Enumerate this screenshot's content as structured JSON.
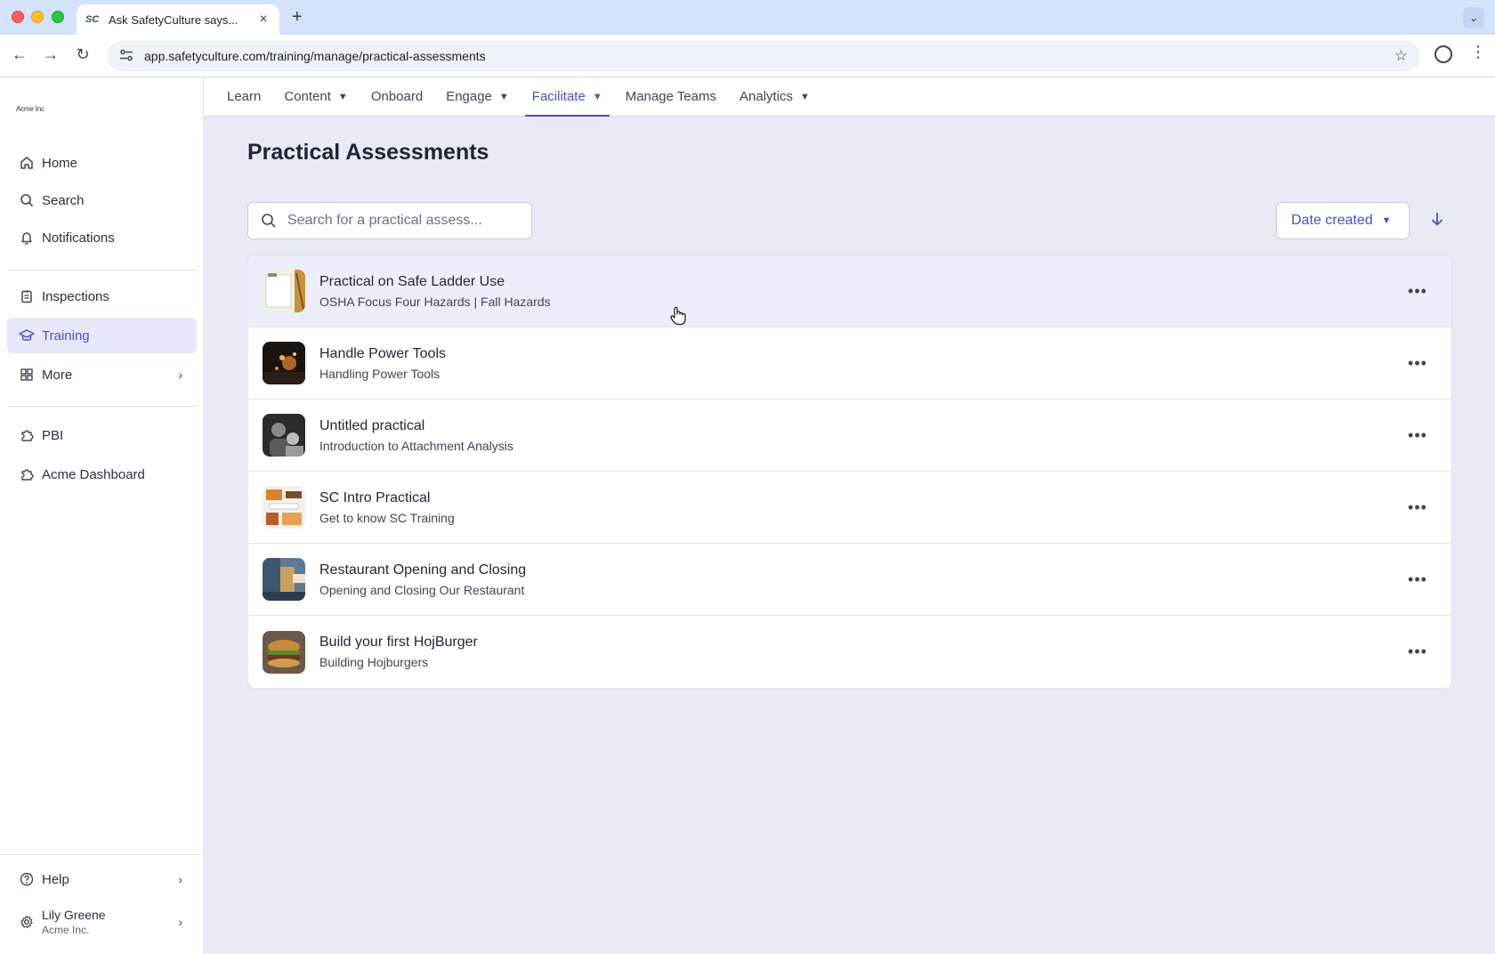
{
  "browser": {
    "tab_title": "Ask SafetyCulture says...",
    "tab_favicon": "SC",
    "url": "app.safetyculture.com/training/manage/practical-assessments",
    "icons": [
      "back-icon",
      "forward-icon",
      "reload-icon",
      "site-settings-icon",
      "bookmark-star-icon",
      "profile-icon",
      "menu-icon"
    ]
  },
  "brand": {
    "logo_text": "Acme Inc"
  },
  "sidebar": {
    "items": [
      {
        "label": "Home",
        "icon": "home-icon"
      },
      {
        "label": "Search",
        "icon": "search-icon"
      },
      {
        "label": "Notifications",
        "icon": "bell-icon"
      },
      {
        "label": "Inspections",
        "icon": "clipboard-icon"
      },
      {
        "label": "Training",
        "icon": "graduation-cap-icon",
        "active": true
      },
      {
        "label": "More",
        "icon": "grid-icon"
      },
      {
        "label": "PBI",
        "icon": "puzzle-icon"
      },
      {
        "label": "Acme Dashboard",
        "icon": "puzzle-icon"
      }
    ],
    "help_label": "Help",
    "user": {
      "name": "Lily Greene",
      "org": "Acme Inc."
    }
  },
  "topnav": {
    "items": [
      {
        "label": "Learn"
      },
      {
        "label": "Content",
        "dropdown": true
      },
      {
        "label": "Onboard"
      },
      {
        "label": "Engage",
        "dropdown": true
      },
      {
        "label": "Facilitate",
        "dropdown": true,
        "active": true
      },
      {
        "label": "Manage Teams"
      },
      {
        "label": "Analytics",
        "dropdown": true
      }
    ]
  },
  "main": {
    "title": "Practical Assessments",
    "search_placeholder": "Search for a practical assess...",
    "sort_value": "Date created",
    "sort_direction": "descending"
  },
  "assessments": [
    {
      "title": "Practical on Safe Ladder Use",
      "subtitle": "OSHA Focus Four Hazards | Fall Hazards"
    },
    {
      "title": "Handle Power Tools",
      "subtitle": "Handling Power Tools"
    },
    {
      "title": "Untitled practical",
      "subtitle": "Introduction to Attachment Analysis"
    },
    {
      "title": "SC Intro Practical",
      "subtitle": "Get to know SC Training"
    },
    {
      "title": "Restaurant Opening and Closing",
      "subtitle": "Opening and Closing Our Restaurant"
    },
    {
      "title": "Build your first HojBurger",
      "subtitle": "Building Hojburgers"
    }
  ],
  "colors": {
    "accent": "#4a4fc2",
    "main_bg": "#e8ebf6",
    "row_hover": "#eceefc"
  }
}
